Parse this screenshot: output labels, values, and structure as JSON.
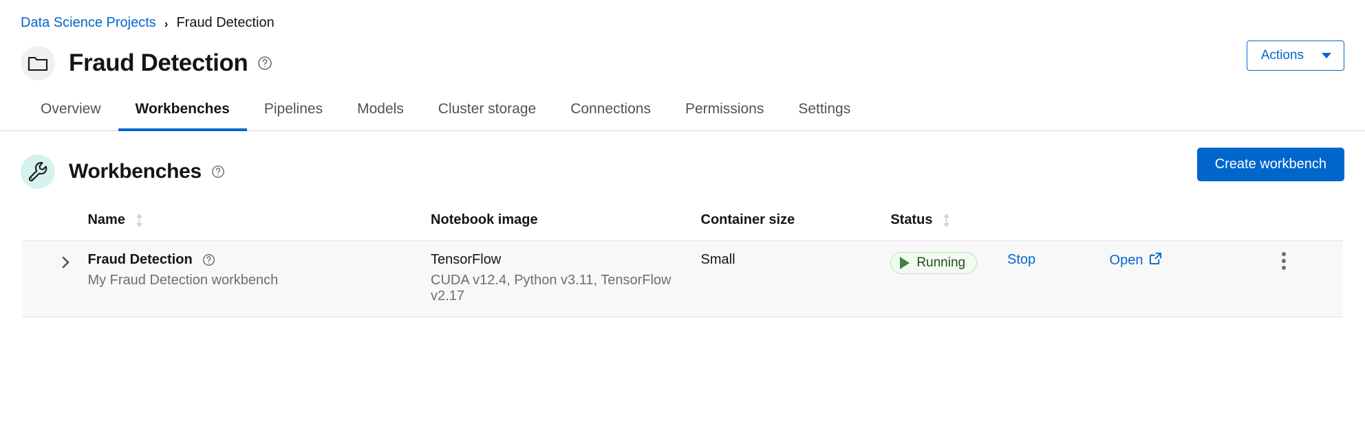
{
  "breadcrumb": {
    "parent": "Data Science Projects",
    "separator": "›",
    "current": "Fraud Detection"
  },
  "header": {
    "title": "Fraud Detection",
    "project_icon": "folder-icon",
    "help_icon": "help-circle-icon",
    "actions_label": "Actions",
    "caret_icon": "caret-down-icon"
  },
  "tabs": [
    {
      "label": "Overview",
      "active": false
    },
    {
      "label": "Workbenches",
      "active": true
    },
    {
      "label": "Pipelines",
      "active": false
    },
    {
      "label": "Models",
      "active": false
    },
    {
      "label": "Cluster storage",
      "active": false
    },
    {
      "label": "Connections",
      "active": false
    },
    {
      "label": "Permissions",
      "active": false
    },
    {
      "label": "Settings",
      "active": false
    }
  ],
  "section": {
    "title": "Workbenches",
    "icon": "wrench-icon",
    "help_icon": "help-circle-icon",
    "create_label": "Create workbench"
  },
  "table": {
    "columns": [
      {
        "label": "Name",
        "sortable": true
      },
      {
        "label": "Notebook image",
        "sortable": false
      },
      {
        "label": "Container size",
        "sortable": false
      },
      {
        "label": "Status",
        "sortable": true
      }
    ],
    "rows": [
      {
        "expand_icon": "chevron-right-icon",
        "name": "Fraud Detection",
        "name_help_icon": "help-circle-icon",
        "description": "My Fraud Detection workbench",
        "notebook_image": "TensorFlow",
        "notebook_image_detail": "CUDA v12.4, Python v3.11, TensorFlow v2.17",
        "container_size": "Small",
        "status": "Running",
        "status_icon": "play-icon",
        "stop_label": "Stop",
        "open_label": "Open",
        "open_icon": "external-link-icon",
        "kebab_icon": "kebab-menu-icon"
      }
    ]
  },
  "colors": {
    "link": "#0066cc",
    "primary_button": "#0066cc",
    "status_running_text": "#1e4f18",
    "status_running_bg": "#f3faf2",
    "status_running_border": "#bde5b8",
    "section_icon_bg": "#d6f2ec",
    "row_bg": "#f8f8f8"
  }
}
